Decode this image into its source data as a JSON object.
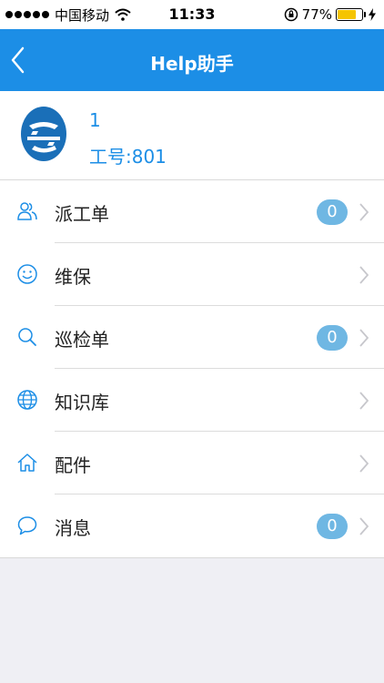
{
  "status_bar": {
    "carrier": "中国移动",
    "time": "11:33",
    "battery": "77%",
    "battery_level": 0.77
  },
  "nav": {
    "title": "Help助手",
    "back_icon": "chevron-left-icon"
  },
  "profile": {
    "name": "1",
    "employee_id": "工号:801",
    "avatar": "company-logo"
  },
  "menu": {
    "items": [
      {
        "label": "派工单",
        "icon": "users-icon",
        "badge": "0"
      },
      {
        "label": "维保",
        "icon": "smiley-icon",
        "badge": null
      },
      {
        "label": "巡检单",
        "icon": "search-icon",
        "badge": "0"
      },
      {
        "label": "知识库",
        "icon": "globe-icon",
        "badge": null
      },
      {
        "label": "配件",
        "icon": "home-icon",
        "badge": null
      },
      {
        "label": "消息",
        "icon": "chat-bubble-icon",
        "badge": "0"
      }
    ]
  },
  "colors": {
    "accent": "#1c8ee6",
    "badge": "#6fb7e3",
    "battery": "#f5c400"
  }
}
